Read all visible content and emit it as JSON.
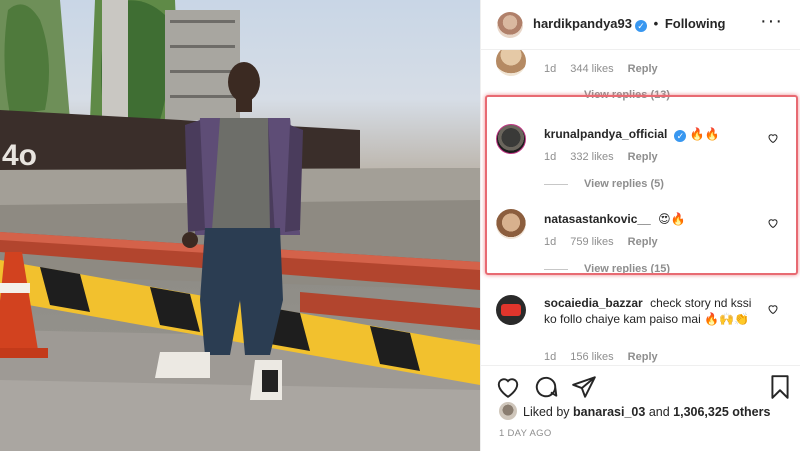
{
  "post": {
    "username": "hardikpandya93",
    "follow_status": "Following",
    "separator": "•",
    "more_label": "···"
  },
  "comments": [
    {
      "username": "",
      "text": "",
      "time": "1d",
      "likes": "344 likes",
      "reply": "Reply",
      "view_replies": "View replies (13)"
    },
    {
      "username": "krunalpandya_official",
      "verified": true,
      "text": "🔥🔥",
      "time": "1d",
      "likes": "332 likes",
      "reply": "Reply",
      "view_replies": "View replies (5)"
    },
    {
      "username": "natasastankovic__",
      "text": "😍🔥",
      "time": "1d",
      "likes": "759 likes",
      "reply": "Reply",
      "view_replies": "View replies (15)"
    },
    {
      "username": "socaiedia_bazzar",
      "text": "check story nd kssi ko follo chaiye kam paiso mai 🔥🙌👏",
      "time": "1d",
      "likes": "156 likes",
      "reply": "Reply"
    }
  ],
  "likes": {
    "prefix": "Liked by",
    "user": "banarasi_03",
    "joiner": "and",
    "others": "1,306,325 others"
  },
  "timestamp": "1 DAY AGO",
  "icons": [
    "heart-icon",
    "comment-icon",
    "share-icon",
    "bookmark-icon",
    "verified-badge-icon",
    "more-options-icon"
  ],
  "colors": {
    "verified": "#3897f0",
    "highlight_border": "#e86a72",
    "meta_gray": "#8e8e8e"
  }
}
